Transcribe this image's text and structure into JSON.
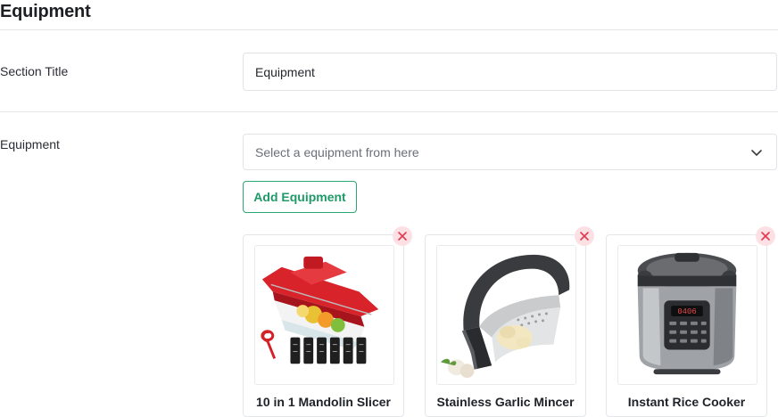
{
  "page": {
    "title": "Equipment"
  },
  "section_title": {
    "label": "Section Title",
    "value": "Equipment"
  },
  "equipment": {
    "label": "Equipment",
    "select_placeholder": "Select a equipment from here",
    "add_button_label": "Add Equipment",
    "items": [
      {
        "name": "10 in 1 Mandolin Slicer",
        "image": "mandolin-slicer"
      },
      {
        "name": "Stainless Garlic Mincer",
        "image": "garlic-mincer"
      },
      {
        "name": "Instant Rice Cooker",
        "image": "rice-cooker"
      }
    ]
  },
  "colors": {
    "accent": "#1f9a68",
    "remove_bg": "#fde0e4",
    "remove_icon": "#e0384f"
  },
  "icons": {
    "dropdown": "chevron-down-icon",
    "remove": "close-icon"
  }
}
